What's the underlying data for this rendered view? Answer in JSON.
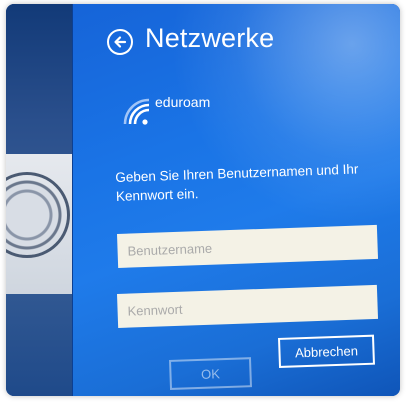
{
  "panel": {
    "title": "Netzwerke",
    "back_icon": "back-arrow-icon"
  },
  "network": {
    "name": "eduroam",
    "icon": "wifi-secured-icon"
  },
  "login": {
    "prompt": "Geben Sie Ihren Benutzernamen und Ihr Kennwort ein.",
    "username": {
      "placeholder": "Benutzername",
      "value": ""
    },
    "password": {
      "placeholder": "Kennwort",
      "value": ""
    }
  },
  "buttons": {
    "ok_label": "OK",
    "cancel_label": "Abbrechen"
  },
  "colors": {
    "panel_blue": "#1a74e6",
    "field_background": "#f4f2e6",
    "text_white": "#ffffff"
  }
}
